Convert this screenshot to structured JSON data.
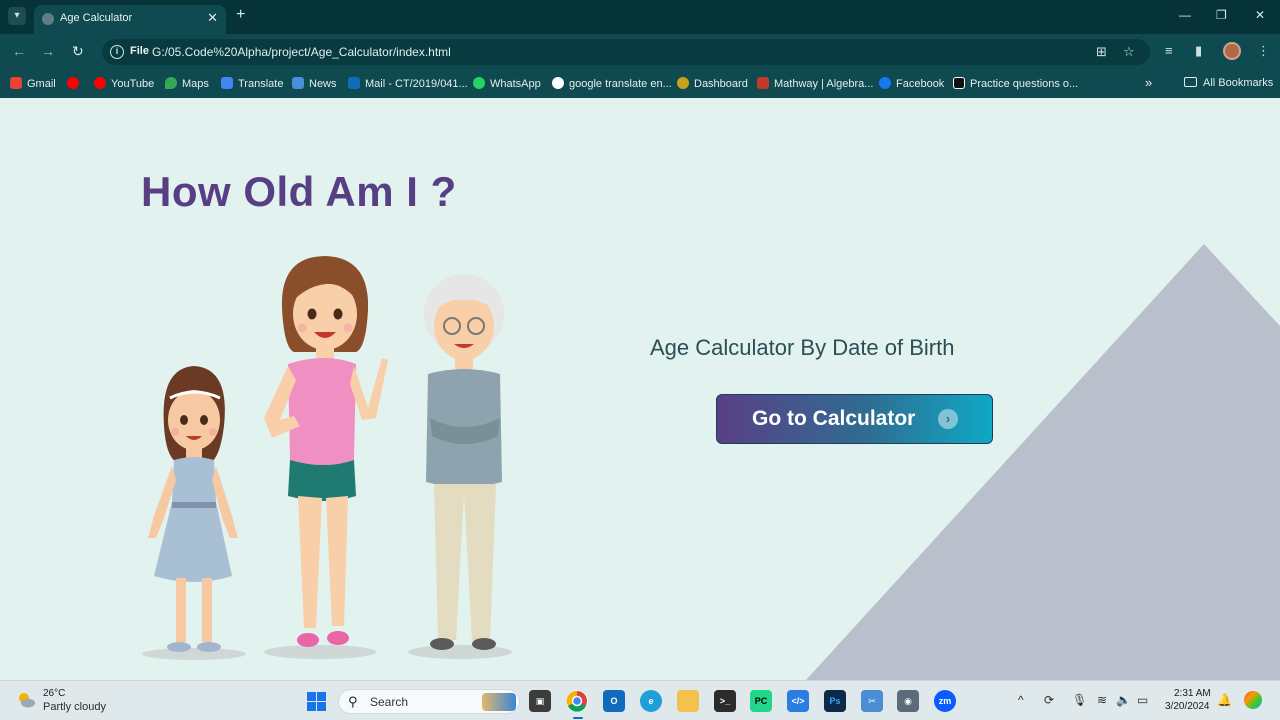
{
  "browser": {
    "tab_title": "Age Calculator",
    "url_scheme": "File",
    "url": "G:/05.Code%20Alpha/project/Age_Calculator/index.html"
  },
  "bookmarks": {
    "items": [
      {
        "label": "Gmail",
        "color": "#ea4335"
      },
      {
        "label": "",
        "color": "#ff0000"
      },
      {
        "label": "YouTube",
        "color": "#ff0000"
      },
      {
        "label": "Maps",
        "color": "#34a853"
      },
      {
        "label": "Translate",
        "color": "#4285f4"
      },
      {
        "label": "News",
        "color": "#4a90d9"
      },
      {
        "label": "Mail - CT/2019/041...",
        "color": "#0f6cbd"
      },
      {
        "label": "WhatsApp",
        "color": "#25d366"
      },
      {
        "label": "google translate en...",
        "color": "#ffffff"
      },
      {
        "label": "Dashboard",
        "color": "#c7a21f"
      },
      {
        "label": "Mathway | Algebra...",
        "color": "#c0392b"
      },
      {
        "label": "Facebook",
        "color": "#1877f2"
      },
      {
        "label": "Practice questions o...",
        "color": "#111111"
      }
    ],
    "all_bookmarks": "All Bookmarks"
  },
  "page": {
    "heading": "How Old Am I ?",
    "subtitle": "Age Calculator By Date of Birth",
    "cta_label": "Go to Calculator"
  },
  "taskbar": {
    "weather_temp": "26°C",
    "weather_condition": "Partly cloudy",
    "search_label": "Search",
    "time": "2:31 AM",
    "date": "3/20/2024"
  },
  "colors": {
    "heading": "#583f83",
    "page_bg": "#e2f2ef",
    "triangle": "#b9bfcb",
    "cta_start": "#5a3f86",
    "cta_end": "#0fa9c6"
  }
}
